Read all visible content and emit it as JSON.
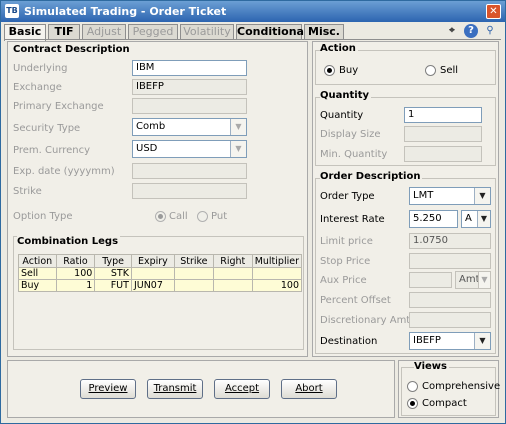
{
  "window": {
    "app_icon": "TB",
    "title": "Simulated Trading - Order Ticket",
    "close_symbol": "✕"
  },
  "tabs": [
    {
      "label": "Basic",
      "state": "selected"
    },
    {
      "label": "TIF",
      "state": "enabled"
    },
    {
      "label": "Adjust",
      "state": "disabled"
    },
    {
      "label": "Pegged",
      "state": "disabled"
    },
    {
      "label": "Volatility",
      "state": "disabled"
    },
    {
      "label": "Conditional",
      "state": "enabled"
    },
    {
      "label": "Misc.",
      "state": "enabled"
    }
  ],
  "toolbar_icons": [
    "crosshair-icon",
    "help-icon",
    "pin-icon"
  ],
  "contract": {
    "title": "Contract Description",
    "underlying_label": "Underlying",
    "underlying": "IBM",
    "exchange_label": "Exchange",
    "exchange": "IBEFP",
    "primary_exchange_label": "Primary Exchange",
    "primary_exchange": "",
    "security_type_label": "Security Type",
    "security_type": "Comb",
    "currency_label": "Prem. Currency",
    "currency": "USD",
    "exp_label": "Exp. date (yyyymm)",
    "exp": "",
    "strike_label": "Strike",
    "strike": "",
    "option_type_label": "Option Type",
    "call_label": "Call",
    "put_label": "Put",
    "option_selected": "Call"
  },
  "legs": {
    "title": "Combination Legs",
    "columns": [
      "Action",
      "Ratio",
      "Type",
      "Expiry",
      "Strike",
      "Right",
      "Multiplier"
    ],
    "rows": [
      [
        "Sell",
        "100",
        "STK",
        "",
        "",
        "",
        ""
      ],
      [
        "Buy",
        "1",
        "FUT",
        "JUN07",
        "",
        "",
        "100"
      ]
    ]
  },
  "action": {
    "title": "Action",
    "buy_label": "Buy",
    "sell_label": "Sell",
    "selected": "Buy"
  },
  "quantity": {
    "title": "Quantity",
    "quantity_label": "Quantity",
    "quantity": "1",
    "display_size_label": "Display Size",
    "min_quantity_label": "Min. Quantity"
  },
  "order": {
    "title": "Order Description",
    "order_type_label": "Order Type",
    "order_type": "LMT",
    "interest_rate_label": "Interest Rate",
    "interest_rate": "5.250",
    "rate_unit": "A",
    "limit_price_label": "Limit price",
    "limit_price": "1.0750",
    "stop_price_label": "Stop Price",
    "aux_price_label": "Aux Price",
    "aux_unit": "Amt",
    "percent_offset_label": "Percent Offset",
    "discretionary_label": "Discretionary Amt",
    "destination_label": "Destination",
    "destination": "IBEFP"
  },
  "views": {
    "title": "Views",
    "comprehensive_label": "Comprehensive",
    "compact_label": "Compact",
    "selected": "Compact"
  },
  "buttons": {
    "preview": "Preview",
    "transmit": "Transmit",
    "accept": "Accept",
    "abort": "Abort"
  },
  "colors": {
    "title_bar": "#2c64b0",
    "row_highlight": "#fefcd6",
    "close_button": "#d9542b"
  }
}
